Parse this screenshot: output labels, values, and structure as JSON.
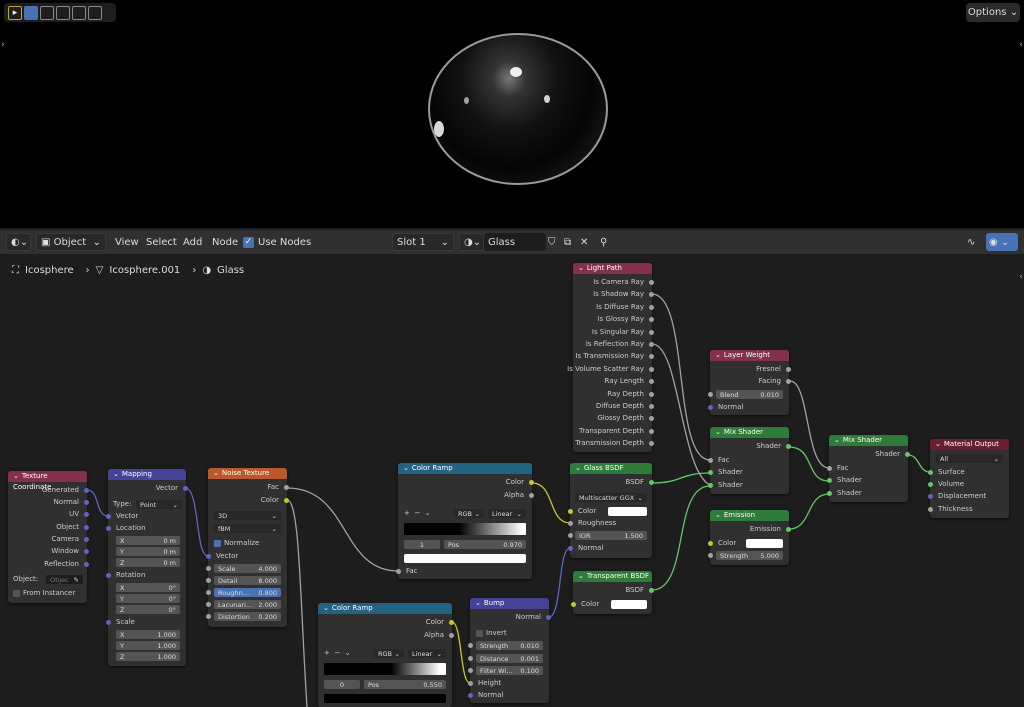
{
  "viewport": {
    "options_label": "Options"
  },
  "header": {
    "editor_type_icon": "shader-editor-icon",
    "object_mode": "Object",
    "menus": [
      "View",
      "Select",
      "Add",
      "Node"
    ],
    "use_nodes_label": "Use Nodes",
    "slot": "Slot 1",
    "material_name": "Glass"
  },
  "breadcrumb": {
    "object": "Icosphere",
    "mesh": "Icosphere.001",
    "material": "Glass"
  },
  "nodes": {
    "texcoord": {
      "title": "Texture Coordinate",
      "outputs": [
        "Generated",
        "Normal",
        "UV",
        "Object",
        "Camera",
        "Window",
        "Reflection"
      ],
      "object_label": "Object:",
      "object_placeholder": "Objec",
      "from_instancer": "From Instancer"
    },
    "mapping": {
      "title": "Mapping",
      "out": "Vector",
      "type_label": "Type:",
      "type_value": "Point",
      "vector": "Vector",
      "location": "Location",
      "loc": [
        [
          "X",
          "0 m"
        ],
        [
          "Y",
          "0 m"
        ],
        [
          "Z",
          "0 m"
        ]
      ],
      "rotation": "Rotation",
      "rot": [
        [
          "X",
          "0°"
        ],
        [
          "Y",
          "0°"
        ],
        [
          "Z",
          "0°"
        ]
      ],
      "scale": "Scale",
      "scl": [
        [
          "X",
          "1.000"
        ],
        [
          "Y",
          "1.000"
        ],
        [
          "Z",
          "1.000"
        ]
      ]
    },
    "noise": {
      "title": "Noise Texture",
      "fac": "Fac",
      "color": "Color",
      "dim": "3D",
      "type": "fBM",
      "normalize": "Normalize",
      "vector": "Vector",
      "fields": [
        [
          "Scale",
          "4.000"
        ],
        [
          "Detail",
          "8.000"
        ],
        [
          "Roughn…",
          "0.800"
        ],
        [
          "Lacunari…",
          "2.000"
        ],
        [
          "Distortion",
          "0.200"
        ]
      ]
    },
    "ramp1": {
      "title": "Color Ramp",
      "color": "Color",
      "alpha": "Alpha",
      "mode": "RGB",
      "interp": "Linear",
      "index": "1",
      "pos_label": "Pos",
      "pos": "0.970",
      "fac": "Fac"
    },
    "ramp2": {
      "title": "Color Ramp",
      "color": "Color",
      "alpha": "Alpha",
      "mode": "RGB",
      "interp": "Linear",
      "index": "0",
      "pos_label": "Pos",
      "pos": "0.550"
    },
    "bump": {
      "title": "Bump",
      "normal_out": "Normal",
      "invert": "Invert",
      "fields": [
        [
          "Strength",
          "0.010"
        ],
        [
          "Distance",
          "0.001"
        ],
        [
          "Filter Wi…",
          "0.100"
        ]
      ],
      "height": "Height",
      "normal_in": "Normal"
    },
    "lightpath": {
      "title": "Light Path",
      "outputs": [
        "Is Camera Ray",
        "Is Shadow Ray",
        "Is Diffuse Ray",
        "Is Glossy Ray",
        "Is Singular Ray",
        "Is Reflection Ray",
        "Is Transmission Ray",
        "Is Volume Scatter Ray",
        "Ray Length",
        "Ray Depth",
        "Diffuse Depth",
        "Glossy Depth",
        "Transparent Depth",
        "Transmission Depth"
      ]
    },
    "glass": {
      "title": "Glass BSDF",
      "bsdf": "BSDF",
      "dist": "Multiscatter GGX",
      "color": "Color",
      "roughness": "Roughness",
      "ior_label": "IOR",
      "ior": "1.500",
      "normal": "Normal"
    },
    "transparent": {
      "title": "Transparent BSDF",
      "bsdf": "BSDF",
      "color": "Color"
    },
    "layerweight": {
      "title": "Layer Weight",
      "fresnel": "Fresnel",
      "facing": "Facing",
      "blend_label": "Blend",
      "blend": "0.010",
      "normal": "Normal"
    },
    "mix1": {
      "title": "Mix Shader",
      "shader_out": "Shader",
      "fac": "Fac",
      "s1": "Shader",
      "s2": "Shader"
    },
    "emission": {
      "title": "Emission",
      "out": "Emission",
      "color": "Color",
      "strength_label": "Strength",
      "strength": "5.000"
    },
    "mix2": {
      "title": "Mix Shader",
      "shader_out": "Shader",
      "fac": "Fac",
      "s1": "Shader",
      "s2": "Shader"
    },
    "output": {
      "title": "Material Output",
      "target": "All",
      "inputs": [
        "Surface",
        "Volume",
        "Displacement",
        "Thickness"
      ]
    }
  }
}
